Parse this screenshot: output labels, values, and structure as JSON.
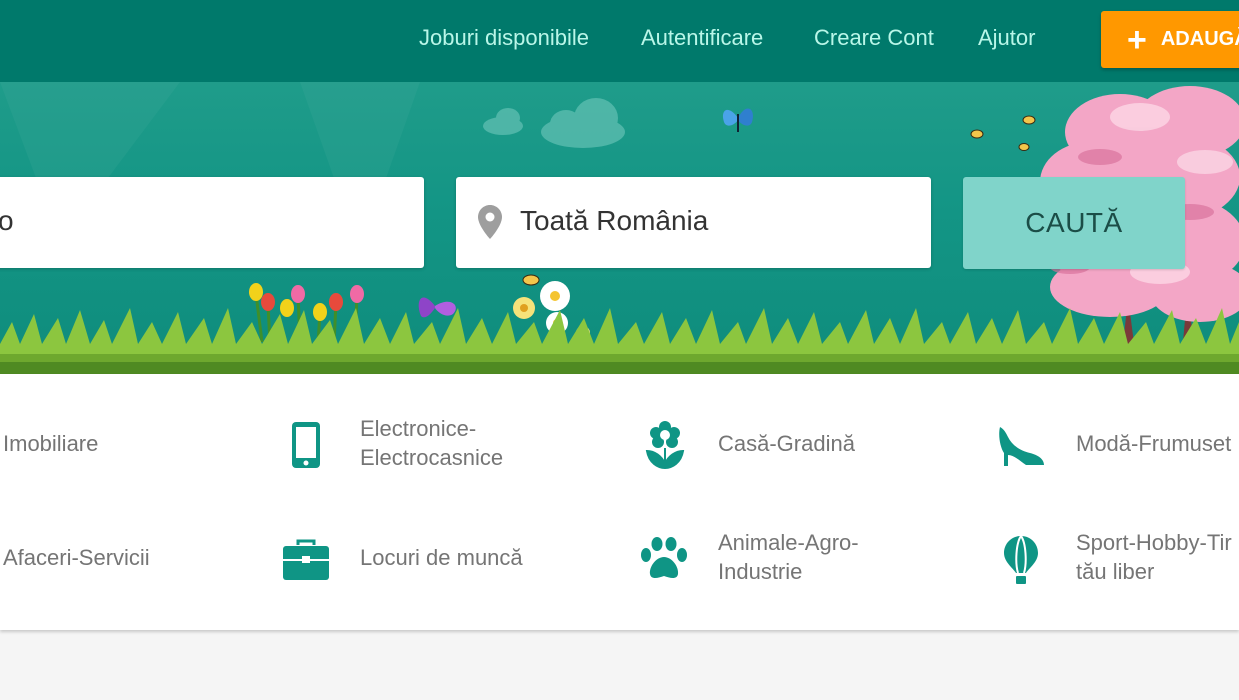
{
  "header": {
    "nav": [
      {
        "label": "Joburi disponibile"
      },
      {
        "label": "Autentificare"
      },
      {
        "label": "Creare Cont"
      },
      {
        "label": "Ajutor"
      }
    ],
    "add_button_label": "ADAUGĂ"
  },
  "search": {
    "keyword_partial_text": "o",
    "location_value": "Toată România",
    "button_label": "CAUTĂ"
  },
  "categories": [
    {
      "label_line1": "Imobiliare",
      "label_line2": "",
      "icon": "house-icon"
    },
    {
      "label_line1": "Electronice-",
      "label_line2": "Electrocasnice",
      "icon": "smartphone-icon"
    },
    {
      "label_line1": "Casă-Gradină",
      "label_line2": "",
      "icon": "flower-icon"
    },
    {
      "label_line1": "Modă-Frumuset",
      "label_line2": "",
      "icon": "high-heel-icon"
    },
    {
      "label_line1": "Afaceri-Servicii",
      "label_line2": "",
      "icon": "briefcase-icon"
    },
    {
      "label_line1": "Locuri de muncă",
      "label_line2": "",
      "icon": "briefcase-icon"
    },
    {
      "label_line1": "Animale-Agro-",
      "label_line2": "Industrie",
      "icon": "paw-icon"
    },
    {
      "label_line1": "Sport-Hobby-Tir",
      "label_line2": "tău liber",
      "icon": "hot-air-balloon-icon"
    }
  ],
  "colors": {
    "header_bg": "#00796b",
    "hero_bg": "#139585",
    "accent_orange": "#ff9800",
    "search_button": "#80d4ca",
    "icon_teal": "#0f9585"
  }
}
